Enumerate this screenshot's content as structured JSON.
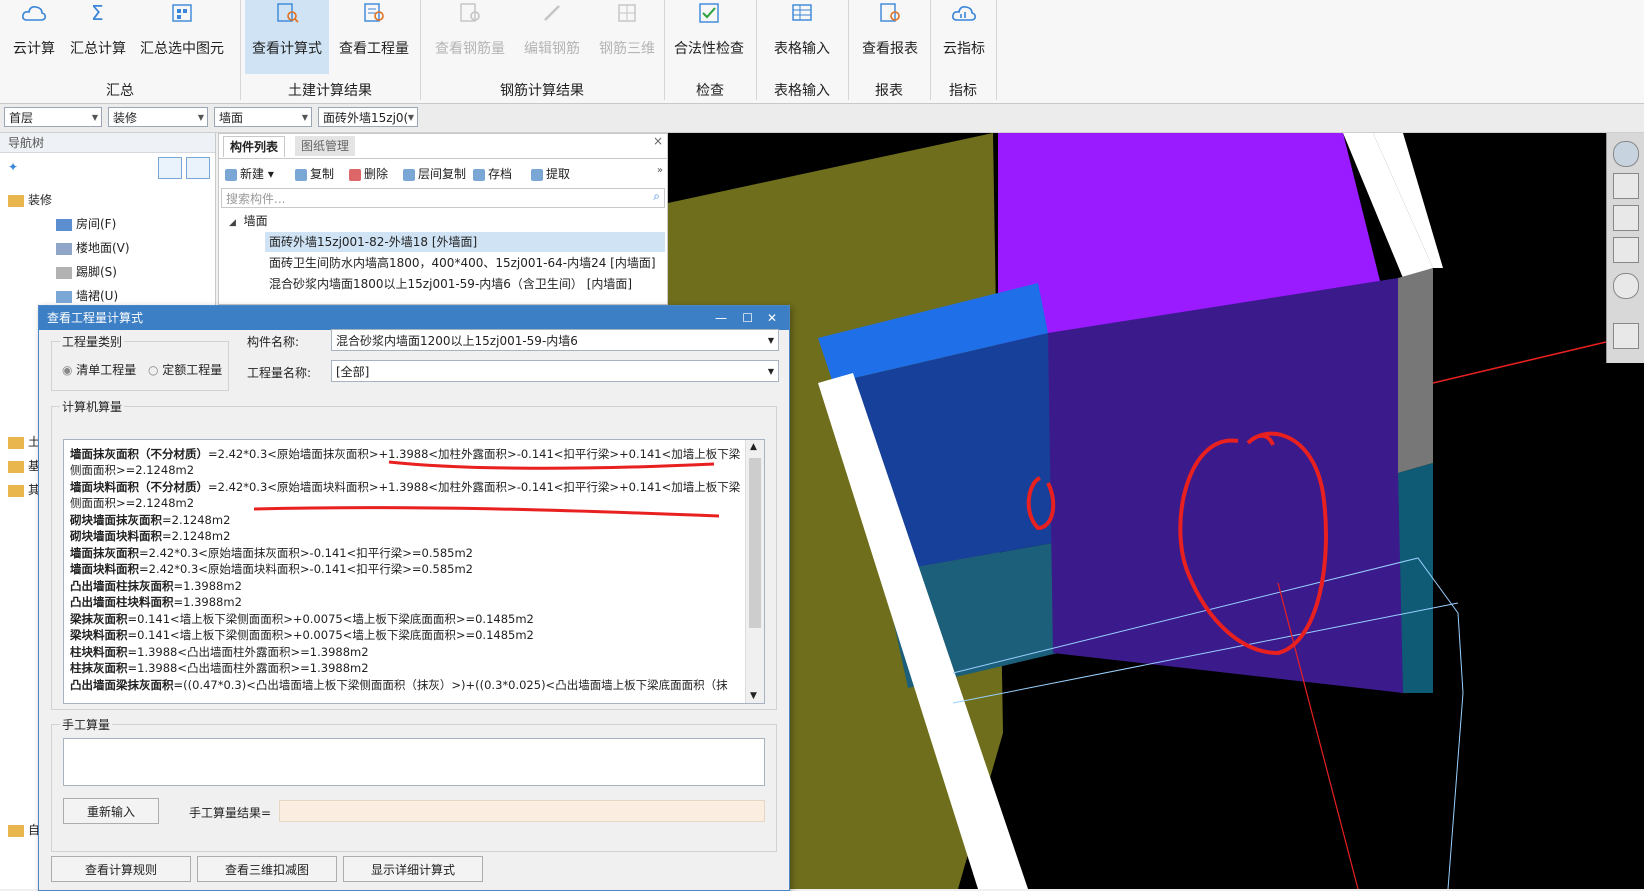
{
  "ribbon": {
    "buttons": [
      {
        "label": "云计算",
        "icon": "cloud-calc-icon"
      },
      {
        "label": "汇总计算",
        "icon": "sigma-icon"
      },
      {
        "label": "汇总选中图元",
        "icon": "sum-selected-icon"
      },
      {
        "label": "查看计算式",
        "icon": "view-formula-icon"
      },
      {
        "label": "查看工程量",
        "icon": "view-quantity-icon"
      },
      {
        "label": "查看钢筋量",
        "icon": "view-rebar-icon"
      },
      {
        "label": "编辑钢筋",
        "icon": "edit-rebar-icon"
      },
      {
        "label": "钢筋三维",
        "icon": "rebar-3d-icon"
      },
      {
        "label": "合法性检查",
        "icon": "check-icon"
      },
      {
        "label": "表格输入",
        "icon": "table-input-icon"
      },
      {
        "label": "查看报表",
        "icon": "report-icon"
      },
      {
        "label": "云指标",
        "icon": "cloud-index-icon"
      }
    ],
    "groups": [
      "汇总",
      "土建计算结果",
      "钢筋计算结果",
      "检查",
      "表格输入",
      "报表",
      "指标"
    ]
  },
  "combos": [
    "首层",
    "装修",
    "墙面",
    "面砖外墙15zj0("
  ],
  "nav": {
    "title": "导航树",
    "items": [
      "装修",
      "房间(F)",
      "楼地面(V)",
      "踢脚(S)",
      "墙裙(U)",
      "土",
      "基",
      "其",
      "自"
    ]
  },
  "complist": {
    "tabs": [
      "构件列表",
      "图纸管理"
    ],
    "toolbar": [
      "新建",
      "复制",
      "删除",
      "层间复制",
      "存档",
      "提取"
    ],
    "search_placeholder": "搜索构件...",
    "group": "墙面",
    "rows": [
      "面砖外墙15zj001-82-外墙18 [外墙面]",
      "面砖卫生间防水内墙高1800，400*400、15zj001-64-内墙24 [内墙面]",
      "混合砂浆内墙面1800以上15zj001-59-内墙6（含卫生间） [内墙面]"
    ]
  },
  "dialog": {
    "title": "查看工程量计算式",
    "qty_type_label": "工程量类别",
    "radio1": "清单工程量",
    "radio2": "定额工程量",
    "comp_name_label": "构件名称:",
    "comp_name_value": "混合砂浆内墙面1200以上15zj001-59-内墙6",
    "qty_name_label": "工程量名称:",
    "qty_name_value": "[全部]",
    "calc_label": "计算机算量",
    "manual_label": "手工算量",
    "reinput_btn": "重新输入",
    "manual_result_label": "手工算量结果=",
    "btn_rules": "查看计算规则",
    "btn_3d": "查看三维扣减图",
    "btn_detail": "显示详细计算式",
    "lines": [
      {
        "b": "墙面抹灰面积（不分材质）",
        "t": "=2.42*0.3<原始墙面抹灰面积>+1.3988<加柱外露面积>-0.141<扣平行梁>+0.141<加墙上板下梁"
      },
      {
        "b": "",
        "t": "侧面面积>=2.1248m2"
      },
      {
        "b": "墙面块料面积（不分材质）",
        "t": "=2.42*0.3<原始墙面块料面积>+1.3988<加柱外露面积>-0.141<扣平行梁>+0.141<加墙上板下梁"
      },
      {
        "b": "",
        "t": "侧面面积>=2.1248m2"
      },
      {
        "b": "砌块墙面抹灰面积",
        "t": "=2.1248m2"
      },
      {
        "b": "砌块墙面块料面积",
        "t": "=2.1248m2"
      },
      {
        "b": "墙面抹灰面积",
        "t": "=2.42*0.3<原始墙面抹灰面积>-0.141<扣平行梁>=0.585m2"
      },
      {
        "b": "墙面块料面积",
        "t": "=2.42*0.3<原始墙面块料面积>-0.141<扣平行梁>=0.585m2"
      },
      {
        "b": "凸出墙面柱抹灰面积",
        "t": "=1.3988m2"
      },
      {
        "b": "凸出墙面柱块料面积",
        "t": "=1.3988m2"
      },
      {
        "b": "梁抹灰面积",
        "t": "=0.141<墙上板下梁侧面面积>+0.0075<墙上板下梁底面面积>=0.1485m2"
      },
      {
        "b": "梁块料面积",
        "t": "=0.141<墙上板下梁侧面面积>+0.0075<墙上板下梁底面面积>=0.1485m2"
      },
      {
        "b": "柱块料面积",
        "t": "=1.3988<凸出墙面柱外露面积>=1.3988m2"
      },
      {
        "b": "柱抹灰面积",
        "t": "=1.3988<凸出墙面柱外露面积>=1.3988m2"
      },
      {
        "b": "凸出墙面梁抹灰面积",
        "t": "=((0.47*0.3)<凸出墙面墙上板下梁侧面面积（抹灰）>)+((0.3*0.025)<凸出墙面墙上板下梁底面面积（抹"
      }
    ]
  },
  "colors": {
    "accent": "#3c7fc4",
    "annotation": "#e82020",
    "purple": "#9a1bff",
    "olive": "#6e6e1c"
  }
}
